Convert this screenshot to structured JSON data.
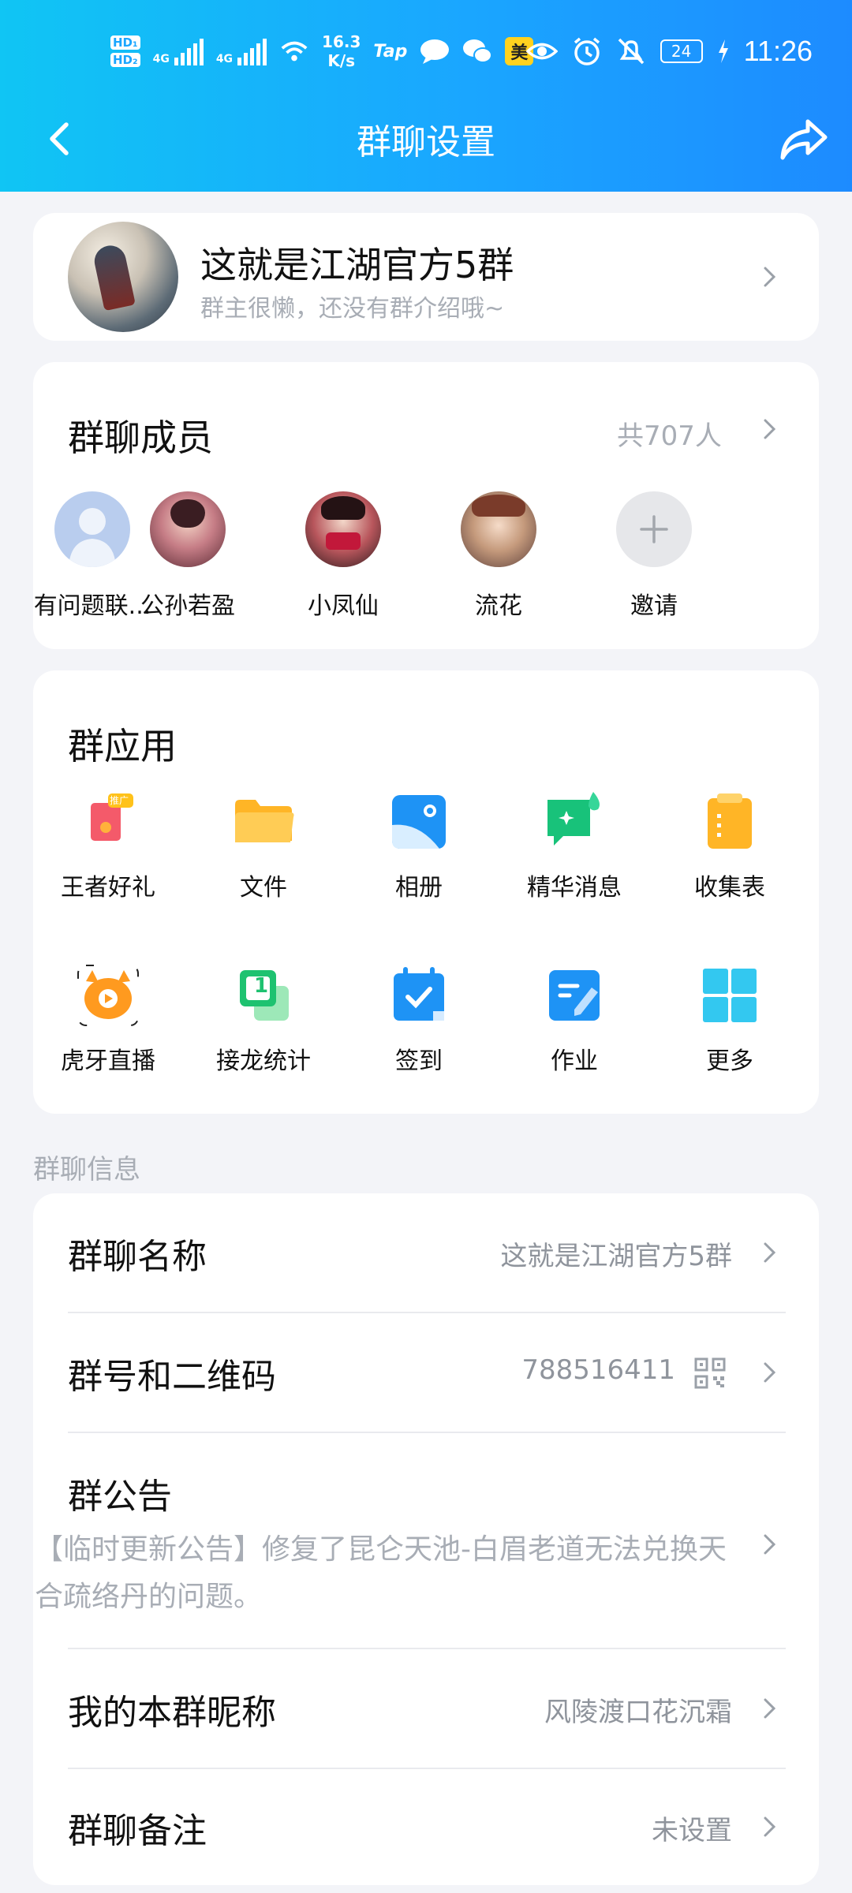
{
  "status_bar": {
    "network": "4G",
    "network2": "4G",
    "speed": "16.3",
    "speed_unit": "K/s",
    "tap": "Tap",
    "mei": "美",
    "battery": "24",
    "time": "11:26",
    "icons": [
      "hd-icon",
      "signal-icon",
      "wifi-icon",
      "tap-icon",
      "message-icon",
      "wechat-icon",
      "meituan-icon",
      "eye-icon",
      "alarm-icon",
      "mute-icon",
      "battery-icon",
      "charging-icon"
    ]
  },
  "nav": {
    "title": "群聊设置",
    "back_icon": "back-chevron-icon",
    "share_icon": "share-icon"
  },
  "group": {
    "name": "这就是江湖官方5群",
    "description": "群主很懒，还没有群介绍哦~"
  },
  "members": {
    "title": "群聊成员",
    "count": "共707人",
    "items": [
      {
        "label": "有问题联..."
      },
      {
        "label": "公孙若盈"
      },
      {
        "label": "小凤仙"
      },
      {
        "label": "流花"
      },
      {
        "label": "邀请"
      }
    ]
  },
  "apps": {
    "title": "群应用",
    "items": [
      {
        "label": "王者好礼",
        "icon": "gift-icon",
        "badge": "推广"
      },
      {
        "label": "文件",
        "icon": "folder-icon"
      },
      {
        "label": "相册",
        "icon": "album-icon"
      },
      {
        "label": "精华消息",
        "icon": "essence-icon"
      },
      {
        "label": "收集表",
        "icon": "clipboard-icon"
      },
      {
        "label": "虎牙直播",
        "icon": "huya-icon"
      },
      {
        "label": "接龙统计",
        "icon": "relay-icon",
        "badge_num": "1"
      },
      {
        "label": "签到",
        "icon": "checkin-icon"
      },
      {
        "label": "作业",
        "icon": "homework-icon"
      },
      {
        "label": "更多",
        "icon": "more-grid-icon"
      }
    ]
  },
  "info": {
    "section_label": "群聊信息",
    "name_key": "群聊名称",
    "name_value": "这就是江湖官方5群",
    "number_key": "群号和二维码",
    "number_value": "788516411",
    "notice_key": "群公告",
    "notice_text": "【临时更新公告】修复了昆仑天池-白眉老道无法兑换天合疏络丹的问题。",
    "nickname_key": "我的本群昵称",
    "nickname_value": "风陵渡口花沉霜",
    "remark_key": "群聊备注",
    "remark_value": "未设置"
  },
  "colors": {
    "header_start": "#10c5f4",
    "header_end": "#1d8bff",
    "background": "#f3f4f8",
    "secondary_text": "#a8adb5"
  }
}
